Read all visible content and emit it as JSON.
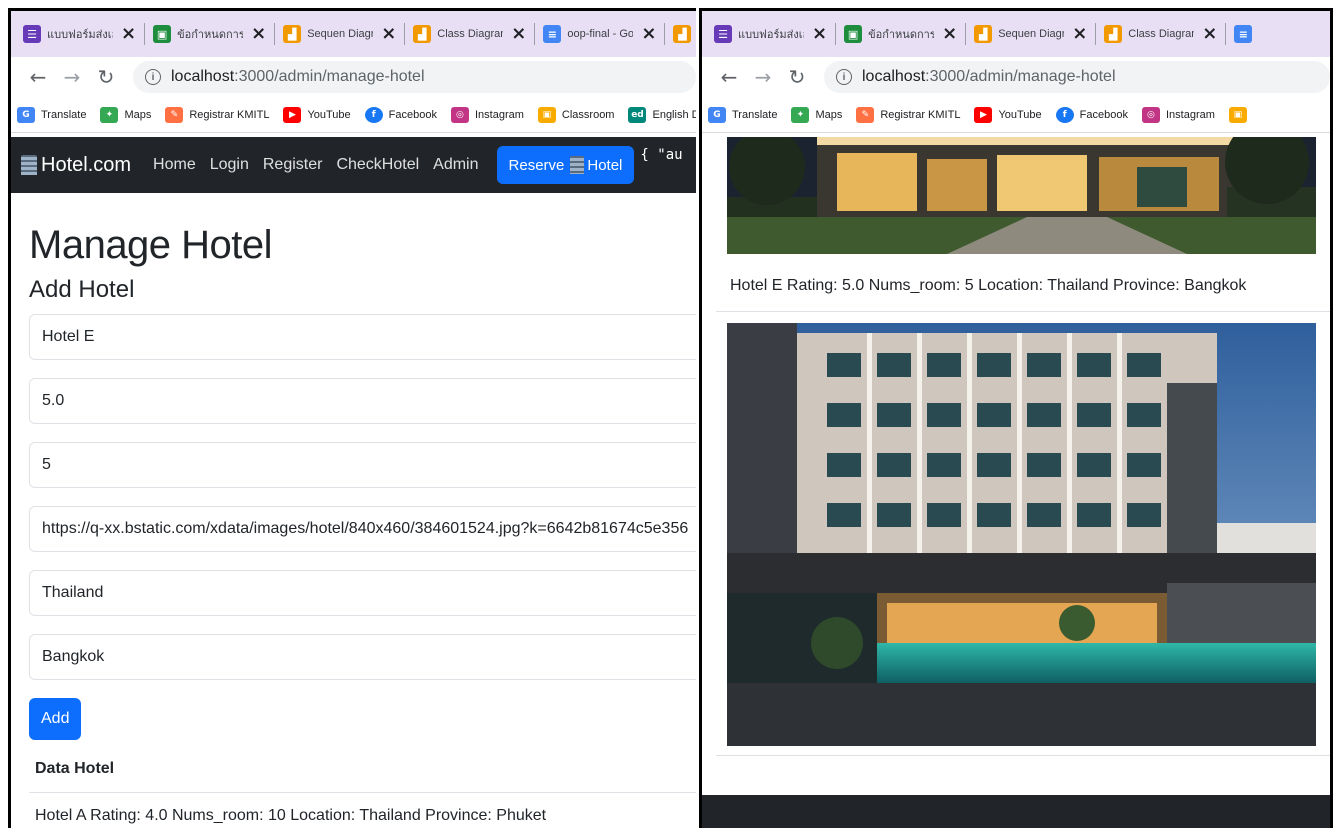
{
  "browser": {
    "tabs": [
      {
        "title": "แบบฟอร์มส่งเอก",
        "icon": "forms-icon",
        "color": "#673ab7"
      },
      {
        "title": "ข้อกำหนดการส่ง",
        "icon": "classroom-icon",
        "color": "#1e8e3e"
      },
      {
        "title": "Sequen Diagr",
        "icon": "diagram-icon",
        "color": "#f29900"
      },
      {
        "title": "Class Diagram",
        "icon": "diagram-icon",
        "color": "#f29900"
      },
      {
        "title": "oop-final - Go",
        "icon": "docs-icon",
        "color": "#4285f4"
      }
    ],
    "url_host": "localhost",
    "url_path": ":3000/admin/manage-hotel",
    "bookmarks": [
      {
        "label": "Translate",
        "icon": "translate-icon",
        "color": "#4285f4"
      },
      {
        "label": "Maps",
        "icon": "maps-icon",
        "color": "#34a853"
      },
      {
        "label": "Registrar KMITL",
        "icon": "registrar-icon",
        "color": "#ff7043"
      },
      {
        "label": "YouTube",
        "icon": "youtube-icon",
        "color": "#ff0000"
      },
      {
        "label": "Facebook",
        "icon": "facebook-icon",
        "color": "#1877f2"
      },
      {
        "label": "Instagram",
        "icon": "instagram-icon",
        "color": "#c13584"
      },
      {
        "label": "Classroom",
        "icon": "classroom-icon",
        "color": "#f9ab00"
      },
      {
        "label": "English Dis",
        "icon": "ed-icon",
        "color": "#00897b"
      }
    ]
  },
  "site": {
    "brand": "Hotel.com",
    "nav": [
      "Home",
      "Login",
      "Register",
      "CheckHotel",
      "Admin"
    ],
    "reserve_prefix": "Reserve",
    "reserve_suffix": "Hotel",
    "json_snip": "{ \"au"
  },
  "form": {
    "page_title": "Manage Hotel",
    "section_title": "Add Hotel",
    "name": "Hotel E",
    "rating": "5.0",
    "nums_room": "5",
    "image_url": "https://q-xx.bstatic.com/xdata/images/hotel/840x460/384601524.jpg?k=6642b81674c5e356",
    "location": "Thailand",
    "province": "Bangkok",
    "add_label": "Add"
  },
  "data_hotel": {
    "title": "Data Hotel",
    "first_row": "Hotel A Rating: 4.0 Nums_room: 10 Location: Thailand Province: Phuket"
  },
  "preview": {
    "caption": "Hotel E Rating: 5.0 Nums_room: 5 Location: Thailand Province: Bangkok"
  }
}
